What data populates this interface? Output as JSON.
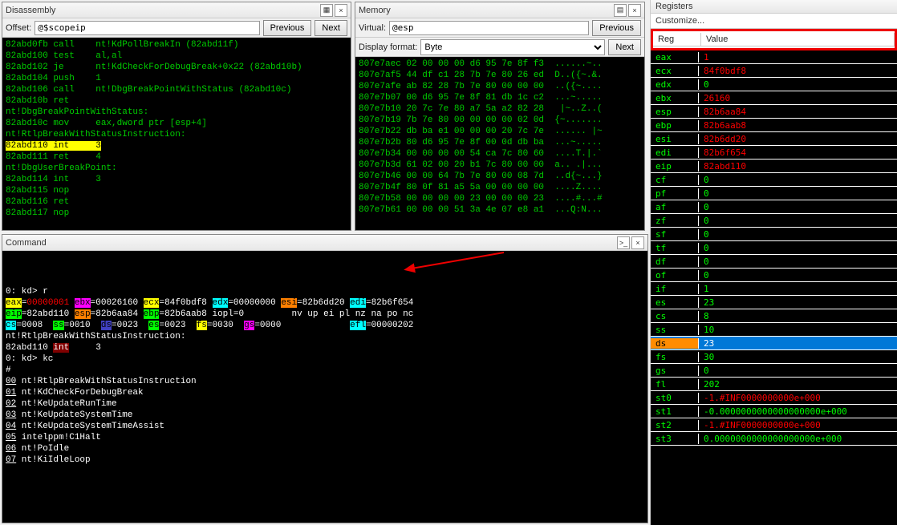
{
  "disassembly": {
    "title": "Disassembly",
    "offset_label": "Offset:",
    "offset_value": "@$scopeip",
    "prev": "Previous",
    "next": "Next",
    "lines": [
      "82abd0fb call    nt!KdPollBreakIn (82abd11f)",
      "82abd100 test    al,al",
      "82abd102 je      nt!KdCheckForDebugBreak+0x22 (82abd10b)",
      "82abd104 push    1",
      "82abd106 call    nt!DbgBreakPointWithStatus (82abd10c)",
      "82abd10b ret",
      "nt!DbgBreakPointWithStatus:",
      "82abd10c mov     eax,dword ptr [esp+4]",
      "nt!RtlpBreakWithStatusInstruction:",
      {
        "hl": true,
        "text": "82abd110 int     3"
      },
      "82abd111 ret     4",
      "nt!DbgUserBreakPoint:",
      "82abd114 int     3",
      "82abd115 nop",
      "82abd116 ret",
      "82abd117 nop"
    ]
  },
  "memory": {
    "title": "Memory",
    "virtual_label": "Virtual:",
    "virtual_value": "@esp",
    "prev": "Previous",
    "next": "Next",
    "format_label": "Display format:",
    "format_value": "Byte",
    "lines": [
      "807e7aec 02 00 00 00 d6 95 7e 8f f3  ......~..",
      "807e7af5 44 df c1 28 7b 7e 80 26 ed  D..({~.&.",
      "807e7afe ab 82 28 7b 7e 80 00 00 00  ..({~....",
      "807e7b07 00 d6 95 7e 8f 81 db 1c c2  ...~.....",
      "807e7b10 20 7c 7e 80 a7 5a a2 82 28   |~..Z..(",
      "807e7b19 7b 7e 80 00 00 00 00 02 0d  {~.......",
      "807e7b22 db ba e1 00 00 00 20 7c 7e  ...... |~",
      "807e7b2b 80 d6 95 7e 8f 00 0d db ba  ...~.....",
      "807e7b34 00 00 00 00 54 ca 7c 80 60  ....T.|.`",
      "807e7b3d 61 02 00 20 b1 7c 80 00 00  a.. .|...",
      "807e7b46 00 00 64 7b 7e 80 00 08 7d  ..d{~...}",
      "807e7b4f 80 0f 81 a5 5a 00 00 00 00  ....Z....",
      "807e7b58 00 00 00 00 23 00 00 00 23  ....#...#",
      "807e7b61 00 00 00 51 3a 4e 07 e8 a1  ...Q:N..."
    ]
  },
  "command": {
    "title": "Command",
    "lines": [
      {
        "t": "prompt",
        "text": "0: kd> r"
      },
      {
        "t": "regs1"
      },
      {
        "t": "regs2"
      },
      {
        "t": "regs3"
      },
      {
        "t": "plain",
        "text": "nt!RtlpBreakWithStatusInstruction:"
      },
      {
        "t": "intline"
      },
      {
        "t": "prompt",
        "text": "0: kd> kc"
      },
      {
        "t": "plain",
        "text": "#"
      },
      {
        "t": "stack",
        "n": "00",
        "text": " nt!RtlpBreakWithStatusInstruction"
      },
      {
        "t": "stack",
        "n": "01",
        "text": " nt!KdCheckForDebugBreak"
      },
      {
        "t": "stack",
        "n": "02",
        "text": " nt!KeUpdateRunTime"
      },
      {
        "t": "stack",
        "n": "03",
        "text": " nt!KeUpdateSystemTime"
      },
      {
        "t": "stack",
        "n": "04",
        "text": " nt!KeUpdateSystemTimeAssist"
      },
      {
        "t": "stack",
        "n": "05",
        "text": " intelppm!C1Halt"
      },
      {
        "t": "stack",
        "n": "06",
        "text": " nt!PoIdle"
      },
      {
        "t": "stack",
        "n": "07",
        "text": " nt!KiIdleLoop"
      }
    ],
    "regs1": {
      "eax": "00000001",
      "ebx": "00026160",
      "ecx": "84f0bdf8",
      "edx": "00000000",
      "esi": "82b6dd20",
      "edi": "82b6f654"
    },
    "regs2": {
      "eip": "82abd110",
      "esp": "82b6aa84",
      "ebp": "82b6aab8",
      "iopl": "iopl=0",
      "flags": "nv up ei pl nz na po nc"
    },
    "regs3": {
      "cs": "0008",
      "ss": "0010",
      "ds": "0023",
      "es": "0023",
      "fs": "0030",
      "gs": "0000",
      "efl": "00000202"
    },
    "intline": {
      "addr": "82abd110 ",
      "mnem": "int",
      "rest": "     3"
    }
  },
  "registers": {
    "title": "Registers",
    "customize": "Customize...",
    "head_reg": "Reg",
    "head_val": "Value",
    "rows": [
      {
        "n": "eax",
        "v": "1",
        "c": "red"
      },
      {
        "n": "ecx",
        "v": "84f0bdf8",
        "c": "red"
      },
      {
        "n": "edx",
        "v": "0",
        "c": "green"
      },
      {
        "n": "ebx",
        "v": "26160",
        "c": "red"
      },
      {
        "n": "esp",
        "v": "82b6aa84",
        "c": "red"
      },
      {
        "n": "ebp",
        "v": "82b6aab8",
        "c": "red"
      },
      {
        "n": "esi",
        "v": "82b6dd20",
        "c": "red"
      },
      {
        "n": "edi",
        "v": "82b6f654",
        "c": "red"
      },
      {
        "n": "eip",
        "v": "82abd110",
        "c": "red"
      },
      {
        "n": "cf",
        "v": "0",
        "c": "green"
      },
      {
        "n": "pf",
        "v": "0",
        "c": "green"
      },
      {
        "n": "af",
        "v": "0",
        "c": "green"
      },
      {
        "n": "zf",
        "v": "0",
        "c": "green"
      },
      {
        "n": "sf",
        "v": "0",
        "c": "green"
      },
      {
        "n": "tf",
        "v": "0",
        "c": "green"
      },
      {
        "n": "df",
        "v": "0",
        "c": "green"
      },
      {
        "n": "of",
        "v": "0",
        "c": "green"
      },
      {
        "n": "if",
        "v": "1",
        "c": "green"
      },
      {
        "n": "es",
        "v": "23",
        "c": "green"
      },
      {
        "n": "cs",
        "v": "8",
        "c": "green"
      },
      {
        "n": "ss",
        "v": "10",
        "c": "green"
      },
      {
        "n": "ds",
        "v": "23",
        "c": "green",
        "sel": "blue"
      },
      {
        "n": "fs",
        "v": "30",
        "c": "green"
      },
      {
        "n": "gs",
        "v": "0",
        "c": "green"
      },
      {
        "n": "fl",
        "v": "202",
        "c": "green"
      },
      {
        "n": "st0",
        "v": "-1.#INF0000000000e+000",
        "c": "red"
      },
      {
        "n": "st1",
        "v": "-0.0000000000000000000e+000",
        "c": "green"
      },
      {
        "n": "st2",
        "v": "-1.#INF0000000000e+000",
        "c": "red"
      },
      {
        "n": "st3",
        "v": " 0.0000000000000000000e+000",
        "c": "green"
      }
    ]
  }
}
